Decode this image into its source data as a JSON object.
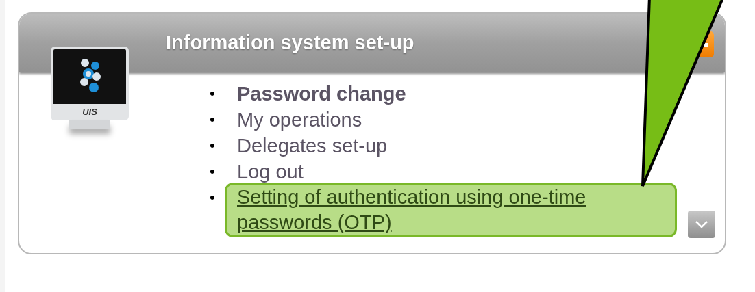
{
  "panel": {
    "title": "Information system set-up",
    "logo_text": "UIS",
    "items": [
      {
        "bullet": "•",
        "label": "Password change",
        "selected": true,
        "highlighted": false
      },
      {
        "bullet": "•",
        "label": "My operations",
        "selected": false,
        "highlighted": false
      },
      {
        "bullet": "•",
        "label": "Delegates set-up",
        "selected": false,
        "highlighted": false
      },
      {
        "bullet": "•",
        "label": "Log out",
        "selected": false,
        "highlighted": false
      },
      {
        "bullet": "•",
        "label": "Setting of authentication using one-time passwords (OTP)",
        "selected": false,
        "highlighted": true
      }
    ]
  }
}
